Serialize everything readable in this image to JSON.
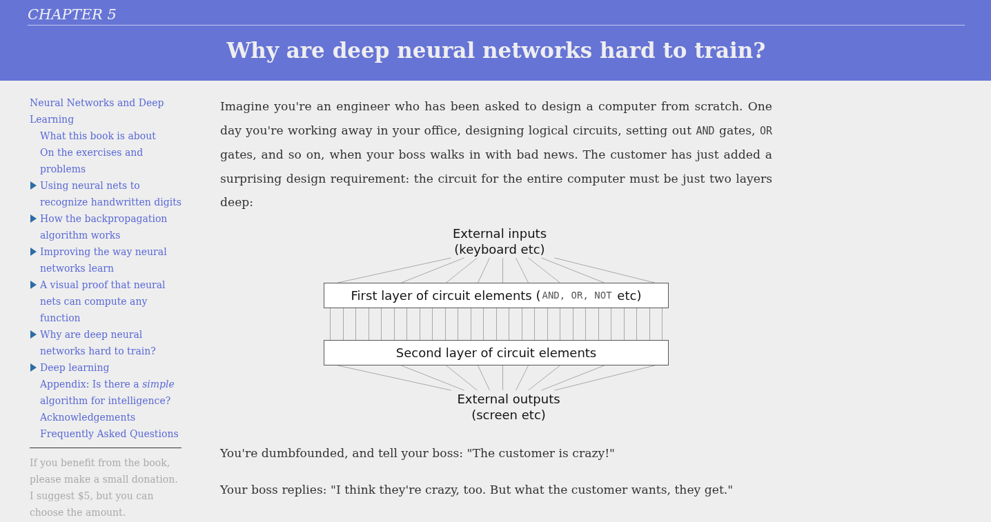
{
  "header": {
    "chapter": "CHAPTER 5",
    "title": "Why are deep neural networks hard to train?"
  },
  "sidebar": {
    "items": [
      {
        "label": "Neural Networks and Deep Learning",
        "expandable": false,
        "children": [
          {
            "label": "What this book is about",
            "expandable": false
          },
          {
            "label": "On the exercises and problems",
            "expandable": false
          },
          {
            "label": "Using neural nets to recognize handwritten digits",
            "expandable": true
          },
          {
            "label": "How the backpropagation algorithm works",
            "expandable": true
          },
          {
            "label": "Improving the way neural networks learn",
            "expandable": true
          },
          {
            "label": "A visual proof that neural nets can compute any function",
            "expandable": true
          },
          {
            "label": "Why are deep neural networks hard to train?",
            "expandable": true
          },
          {
            "label": "Deep learning",
            "expandable": true
          },
          {
            "label": "Appendix: Is there a *simple* algorithm for intelligence?",
            "expandable": false
          },
          {
            "label": "Acknowledgements",
            "expandable": false
          },
          {
            "label": "Frequently Asked Questions",
            "expandable": false
          }
        ]
      }
    ],
    "donation": "If you benefit from the book, please make a small donation. I suggest $5, but you can choose the amount."
  },
  "main": {
    "blocks": [
      {
        "kind": "paragraph",
        "segments": [
          {
            "kind": "text",
            "text": "Imagine you're an engineer who has been asked to design a computer from scratch. One day you're working away in your office, designing logical circuits, setting out "
          },
          {
            "kind": "code",
            "text": "AND"
          },
          {
            "kind": "text",
            "text": " gates, "
          },
          {
            "kind": "code",
            "text": "OR"
          },
          {
            "kind": "text",
            "text": " gates, and so on, when your boss walks in with bad news. The customer has just added a surprising design requirement: the circuit for the entire computer must be just two layers deep:"
          }
        ]
      },
      {
        "kind": "diagram",
        "inputs": [
          "External inputs",
          "(keyboard etc)"
        ],
        "layers": [
          {
            "segments": [
              {
                "kind": "text",
                "text": "First layer of circuit elements ("
              },
              {
                "kind": "code",
                "text": "AND, OR, NOT"
              },
              {
                "kind": "text",
                "text": " etc)"
              }
            ]
          },
          {
            "segments": [
              {
                "kind": "text",
                "text": "Second layer of circuit elements"
              }
            ]
          }
        ],
        "outputs": [
          "External outputs",
          "(screen etc)"
        ]
      },
      {
        "kind": "paragraph",
        "segments": [
          {
            "kind": "text",
            "text": "You're dumbfounded, and tell your boss: \"The customer is crazy!\""
          }
        ]
      },
      {
        "kind": "paragraph",
        "segments": [
          {
            "kind": "text",
            "text": "Your boss replies: \"I think they're crazy, too. But what the customer wants, they get.\""
          }
        ]
      }
    ]
  }
}
